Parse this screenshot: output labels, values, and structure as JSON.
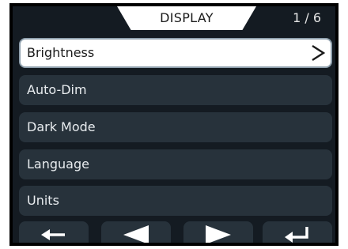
{
  "header": {
    "title": "DISPLAY",
    "page_indicator": "1 / 6"
  },
  "menu": {
    "items": [
      {
        "label": "Brightness",
        "selected": true
      },
      {
        "label": "Auto-Dim",
        "selected": false
      },
      {
        "label": "Dark Mode",
        "selected": false
      },
      {
        "label": "Language",
        "selected": false
      },
      {
        "label": "Units",
        "selected": false
      }
    ],
    "selected_chevron_icon": "chevron-right-icon"
  },
  "footer": {
    "buttons": [
      {
        "action": "back",
        "icon": "arrow-left-icon"
      },
      {
        "action": "previous",
        "icon": "triangle-left-icon"
      },
      {
        "action": "next",
        "icon": "triangle-right-icon"
      },
      {
        "action": "enter",
        "icon": "enter-return-icon"
      }
    ]
  },
  "colors": {
    "screen_background": "#141b22",
    "item_background": "#27323b",
    "selected_background": "#ffffff",
    "text_light": "#e8ecef",
    "text_dark": "#1a1a1a"
  }
}
